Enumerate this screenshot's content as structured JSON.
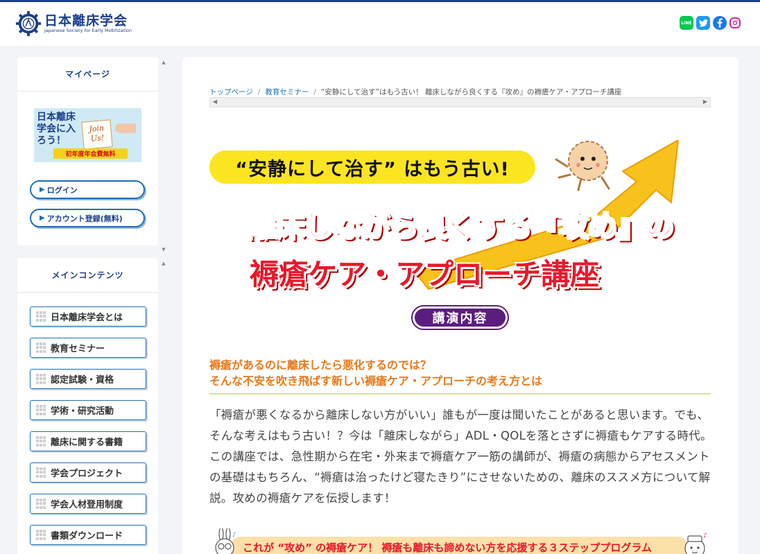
{
  "header": {
    "logo_jp": "日本離床学会",
    "logo_en": "Japanese Society for Early Mobilization",
    "social": [
      "line-icon",
      "twitter-icon",
      "facebook-icon",
      "instagram-icon"
    ],
    "line_label": "LINE"
  },
  "sidebar": {
    "mypage_title": "マイページ",
    "join_banner": {
      "text": "日本離床学会に入ろう！",
      "note": "Join Us!",
      "bar": "初年度年会費無料"
    },
    "login_label": "ログイン",
    "register_label": "アカウント登録(無料)",
    "main_title": "メインコンテンツ",
    "nav": [
      {
        "label": "日本離床学会とは"
      },
      {
        "label": "教育セミナー"
      },
      {
        "label": "認定試験・資格"
      },
      {
        "label": "学術・研究活動"
      },
      {
        "label": "離床に関する書籍"
      },
      {
        "label": "学会プロジェクト"
      },
      {
        "label": "学会人材登用制度"
      },
      {
        "label": "書類ダウンロード"
      }
    ]
  },
  "breadcrumb": {
    "items": [
      "トップページ",
      "教育セミナー"
    ],
    "current": "“安静にして治す”はもう古い！ 離床しながら良くする『攻め』の褥瘡ケア・アプローチ講座"
  },
  "hero": {
    "line1": "“安静にして治す” はもう古い!",
    "line2": "離床しながら良くする『攻め』の",
    "line3": "褥瘡ケア・アプローチ講座"
  },
  "section": {
    "badge": "講演内容",
    "subhead_1": "褥瘡があるのに離床したら悪化するのでは？",
    "subhead_2": "そんな不安を吹き飛ばす新しい褥瘡ケア・アプローチの考え方とは",
    "body": "「褥瘡が悪くなるから離床しない方がいい」誰もが一度は聞いたことがあると思います。でも、そんな考えはもう古い！？今は「離床しながら」ADL・QOLを落とさずに褥瘡もケアする時代。この講座では、急性期から在宅・外来まで褥瘡ケア一筋の講師が、褥瘡の病態からアセスメントの基礎はもちろん、“褥瘡は治ったけど寝たきり”にさせないための、離床のススメ方について解説。攻めの褥瘡ケアを伝授します！",
    "bottom_banner": "これが “攻め” の褥瘡ケア！ 褥瘡も離床も諦めない方を応援する３ステッププログラム"
  }
}
